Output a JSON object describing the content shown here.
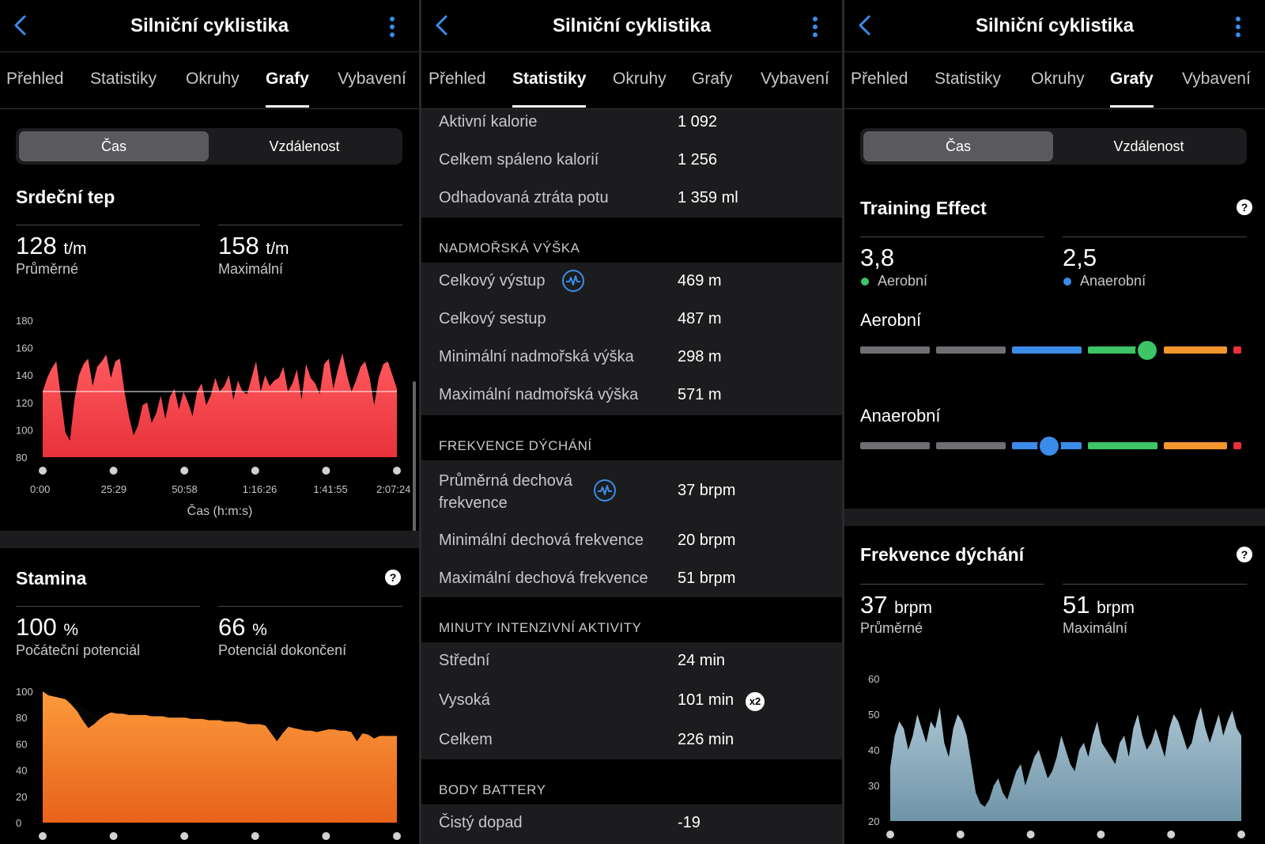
{
  "panels": [
    {
      "header": {
        "title": "Silniční cyklistika"
      },
      "tabs": [
        "Přehled",
        "Statistiky",
        "Okruhy",
        "Grafy",
        "Vybavení"
      ],
      "active_tab": "Grafy",
      "segment": {
        "selected": "Čas",
        "other": "Vzdálenost"
      },
      "heart_rate": {
        "title": "Srdeční tep",
        "avg_value": "128",
        "avg_unit": "t/m",
        "avg_label": "Průměrné",
        "max_value": "158",
        "max_unit": "t/m",
        "max_label": "Maximální"
      },
      "stamina": {
        "title": "Stamina",
        "start_value": "100",
        "start_unit": "%",
        "start_label": "Počáteční potenciál",
        "end_value": "66",
        "end_unit": "%",
        "end_label": "Potenciál dokončení"
      }
    },
    {
      "header": {
        "title": "Silniční cyklistika"
      },
      "tabs": [
        "Přehled",
        "Statistiky",
        "Okruhy",
        "Grafy",
        "Vybavení"
      ],
      "active_tab": "Statistiky",
      "rows_top": [
        {
          "label": "Aktivní kalorie",
          "value": "1 092"
        },
        {
          "label": "Celkem spáleno kalorií",
          "value": "1 256"
        },
        {
          "label": "Odhadovaná ztráta potu",
          "value": "1 359 ml"
        }
      ],
      "sections": [
        {
          "title": "NADMOŘSKÁ VÝŠKA",
          "rows": [
            {
              "label": "Celkový výstup",
              "value": "469 m",
              "icon": "wave-icon"
            },
            {
              "label": "Celkový sestup",
              "value": "487 m"
            },
            {
              "label": "Minimální nadmořská výška",
              "value": "298 m"
            },
            {
              "label": "Maximální nadmořská výška",
              "value": "571 m"
            }
          ]
        },
        {
          "title": "FREKVENCE DÝCHÁNÍ",
          "rows": [
            {
              "label": "Průměrná dechová",
              "label2": "frekvence",
              "value": "37 brpm",
              "icon": "wave-icon"
            },
            {
              "label": "Minimální dechová frekvence",
              "value": "20 brpm"
            },
            {
              "label": "Maximální dechová frekvence",
              "value": "51 brpm"
            }
          ]
        },
        {
          "title": "MINUTY INTENZIVNÍ AKTIVITY",
          "rows": [
            {
              "label": "Střední",
              "value": "24 min"
            },
            {
              "label": "Vysoká",
              "value": "101 min",
              "badge": "x2"
            },
            {
              "label": "Celkem",
              "value": "226 min"
            }
          ]
        },
        {
          "title": "BODY BATTERY",
          "rows": [
            {
              "label": "Čistý dopad",
              "value": "-19"
            }
          ]
        }
      ]
    },
    {
      "header": {
        "title": "Silniční cyklistika"
      },
      "tabs": [
        "Přehled",
        "Statistiky",
        "Okruhy",
        "Grafy",
        "Vybavení"
      ],
      "active_tab": "Grafy",
      "segment": {
        "selected": "Čas",
        "other": "Vzdálenost"
      },
      "training_effect": {
        "title": "Training Effect",
        "aerobic_value": "3,8",
        "aerobic_label": "Aerobní",
        "anaerobic_value": "2,5",
        "anaerobic_label": "Anaerobní",
        "aerobic_scale_label": "Aerobní",
        "anaerobic_scale_label": "Anaerobní",
        "aerobic_level": 3.8,
        "anaerobic_level": 2.5,
        "scale_max": 5
      },
      "breathing": {
        "title": "Frekvence dýchání",
        "avg_value": "37",
        "avg_unit": "brpm",
        "avg_label": "Průměrné",
        "max_value": "51",
        "max_unit": "brpm",
        "max_label": "Maximální"
      }
    }
  ],
  "colors": {
    "hr_fill": "#e8323a",
    "stamina_fill": "#f07a1e",
    "breath_fill": "#8fb0c0",
    "aerobic_dot": "#3cc466",
    "anaerobic_dot": "#3b8ce8",
    "seg_gray": "#6e6e73",
    "seg_blue": "#3b8ce8",
    "seg_green": "#3cc466",
    "seg_orange": "#f2952d",
    "seg_red": "#e8323a"
  },
  "chart_data": [
    {
      "type": "area",
      "title": "Srdeční tep",
      "xlabel": "Čas (h:m:s)",
      "ylabel": "",
      "ylim": [
        80,
        180
      ],
      "yticks": [
        80,
        100,
        120,
        140,
        160,
        180
      ],
      "xticks": [
        "0:00",
        "25:29",
        "50:58",
        "1:16:26",
        "1:41:55",
        "2:07:24"
      ],
      "average_line": 128,
      "series": [
        {
          "values": [
            128,
            138,
            145,
            150,
            124,
            98,
            92,
            122,
            140,
            148,
            152,
            132,
            146,
            150,
            155,
            138,
            150,
            152,
            128,
            110,
            96,
            103,
            118,
            120,
            105,
            112,
            125,
            108,
            124,
            130,
            115,
            128,
            120,
            110,
            128,
            134,
            118,
            125,
            138,
            128,
            132,
            140,
            122,
            136,
            128,
            126,
            138,
            150,
            128,
            140,
            132,
            136,
            138,
            146,
            128,
            134,
            144,
            122,
            148,
            138,
            134,
            126,
            148,
            152,
            130,
            144,
            156,
            140,
            128,
            136,
            146,
            150,
            138,
            118,
            138,
            148,
            150,
            140,
            130
          ]
        }
      ]
    },
    {
      "type": "area",
      "title": "Stamina",
      "xlabel": "",
      "ylabel": "",
      "ylim": [
        0,
        100
      ],
      "yticks": [
        0,
        20,
        40,
        60,
        80,
        100
      ],
      "series": [
        {
          "values": [
            100,
            97,
            96,
            95,
            94,
            92,
            90,
            88,
            86,
            83,
            81,
            82,
            84,
            83,
            83,
            82,
            82,
            82,
            82,
            81,
            81,
            81,
            80,
            80,
            80,
            80,
            79,
            79,
            79,
            78,
            78,
            78,
            77,
            77,
            77,
            76,
            75,
            75,
            75,
            74,
            72,
            70,
            71,
            73,
            72,
            71,
            70,
            70,
            69,
            70,
            71,
            71,
            70,
            70,
            69,
            68,
            68,
            67,
            67,
            66,
            66,
            66,
            66
          ]
        },
        {
          "values": [
            100,
            97,
            96,
            95,
            94,
            90,
            85,
            78,
            72,
            75,
            79,
            82,
            84,
            83,
            83,
            82,
            82,
            82,
            82,
            81,
            81,
            81,
            80,
            80,
            80,
            80,
            79,
            79,
            79,
            78,
            78,
            78,
            77,
            77,
            77,
            76,
            75,
            75,
            75,
            74,
            68,
            62,
            68,
            73,
            72,
            71,
            70,
            70,
            69,
            70,
            71,
            71,
            70,
            70,
            69,
            62,
            68,
            67,
            64,
            66,
            66,
            66,
            66
          ]
        }
      ]
    },
    {
      "type": "area",
      "title": "Frekvence dýchání",
      "xlabel": "",
      "ylabel": "",
      "ylim": [
        20,
        60
      ],
      "yticks": [
        20,
        30,
        40,
        50,
        60
      ],
      "series": [
        {
          "values": [
            35,
            44,
            48,
            46,
            40,
            44,
            50,
            46,
            42,
            48,
            46,
            52,
            42,
            38,
            46,
            50,
            48,
            44,
            36,
            28,
            25,
            24,
            26,
            30,
            32,
            28,
            26,
            30,
            34,
            36,
            30,
            34,
            38,
            40,
            36,
            32,
            34,
            38,
            44,
            40,
            36,
            34,
            40,
            42,
            38,
            44,
            48,
            42,
            40,
            38,
            36,
            42,
            44,
            38,
            46,
            50,
            44,
            40,
            42,
            46,
            42,
            38,
            46,
            50,
            48,
            44,
            40,
            42,
            48,
            52,
            46,
            42,
            46,
            50,
            44,
            48,
            51,
            46,
            44
          ]
        }
      ]
    }
  ]
}
